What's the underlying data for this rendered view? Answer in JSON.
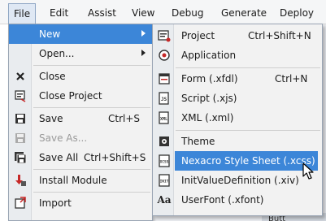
{
  "menubar": {
    "items": [
      {
        "label": "File",
        "active": true
      },
      {
        "label": "Edit"
      },
      {
        "label": "Assist"
      },
      {
        "label": "View"
      },
      {
        "label": "Debug"
      },
      {
        "label": "Generate"
      },
      {
        "label": "Deploy"
      }
    ]
  },
  "background": {
    "button_partial": "Butt"
  },
  "file_menu": {
    "items": [
      {
        "label": "New",
        "icon": "none",
        "has_submenu": true,
        "highlighted": true
      },
      {
        "label": "Open...",
        "icon": "none",
        "has_submenu": true
      },
      {
        "label": "Close",
        "icon": "close-x-icon"
      },
      {
        "label": "Close Project",
        "icon": "close-project-icon"
      },
      {
        "label": "Save",
        "shortcut": "Ctrl+S",
        "icon": "save-icon"
      },
      {
        "label": "Save As...",
        "icon": "save-as-icon",
        "disabled": true
      },
      {
        "label": "Save All",
        "shortcut": "Ctrl+Shift+S",
        "icon": "save-all-icon"
      },
      {
        "label": "Install Module",
        "icon": "install-module-icon"
      },
      {
        "label": "Import",
        "icon": "import-icon"
      }
    ]
  },
  "new_submenu": {
    "items": [
      {
        "label": "Project",
        "shortcut": "Ctrl+Shift+N",
        "icon": "project-icon"
      },
      {
        "label": "Application",
        "icon": "application-icon"
      },
      {
        "label": "Form (.xfdl)",
        "shortcut": "Ctrl+N",
        "icon": "form-icon"
      },
      {
        "label": "Script (.xjs)",
        "icon": "script-icon"
      },
      {
        "label": "XML (.xml)",
        "icon": "xml-icon"
      },
      {
        "label": "Theme",
        "icon": "theme-icon"
      },
      {
        "label": "Nexacro Style Sheet (.xcss)",
        "icon": "xcss-icon",
        "hovered": true
      },
      {
        "label": "InitValueDefinition (.xiv)",
        "icon": "init-value-icon"
      },
      {
        "label": "UserFont (.xfont)",
        "icon": "userfont-icon"
      }
    ]
  },
  "colors": {
    "highlight": "#3c86d8",
    "menu_bg": "#f2f2f2",
    "border": "#9aa5b4"
  }
}
